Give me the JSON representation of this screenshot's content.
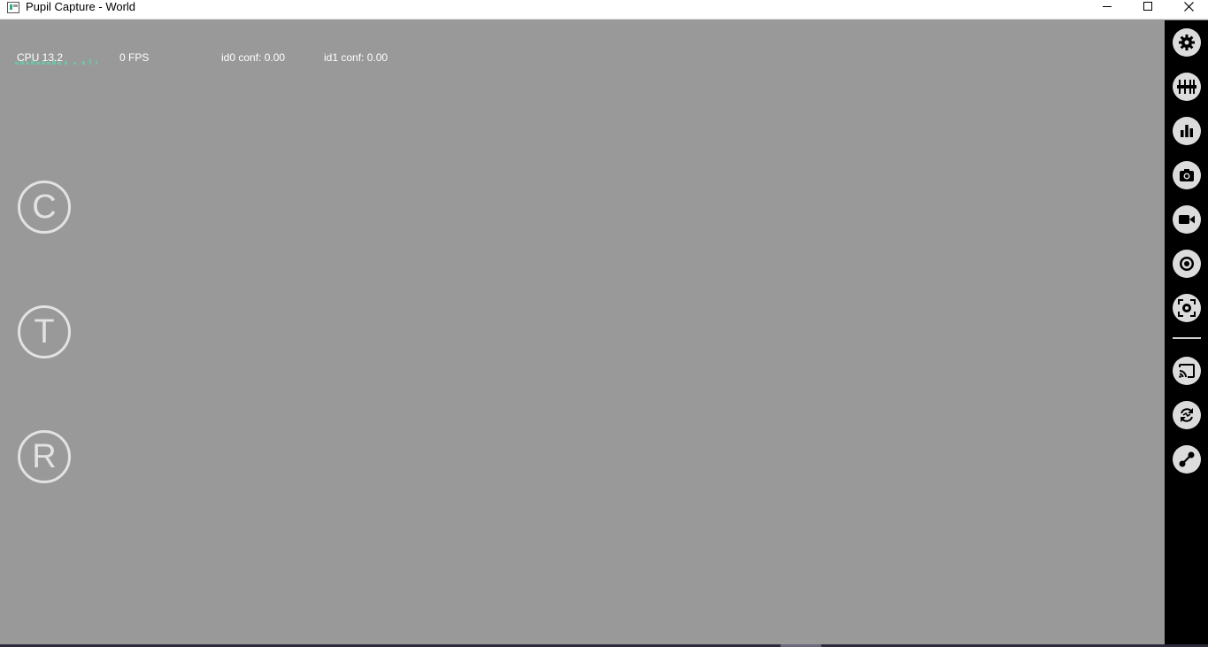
{
  "window": {
    "title": "Pupil Capture - World"
  },
  "stats": {
    "cpu": "CPU 13.2",
    "fps": "0 FPS",
    "id0_conf": "id0 conf: 0.00",
    "id1_conf": "id1 conf: 0.00"
  },
  "quick_buttons": {
    "calibrate": "C",
    "test": "T",
    "record": "R"
  },
  "sidebar": {
    "icons": [
      "gear-icon",
      "sliders-icon",
      "bar-chart-icon",
      "camera-icon",
      "video-icon",
      "target-icon",
      "screen-marker-icon",
      "cast-icon",
      "sync-icon",
      "link-icon"
    ]
  },
  "colors": {
    "canvas": "#999999",
    "sidebar": "#000000",
    "button_fill": "#dcdcdc",
    "button_glyph": "#000000",
    "overlay_text": "#ffffff",
    "cpu_graph": "#66ccaa"
  }
}
